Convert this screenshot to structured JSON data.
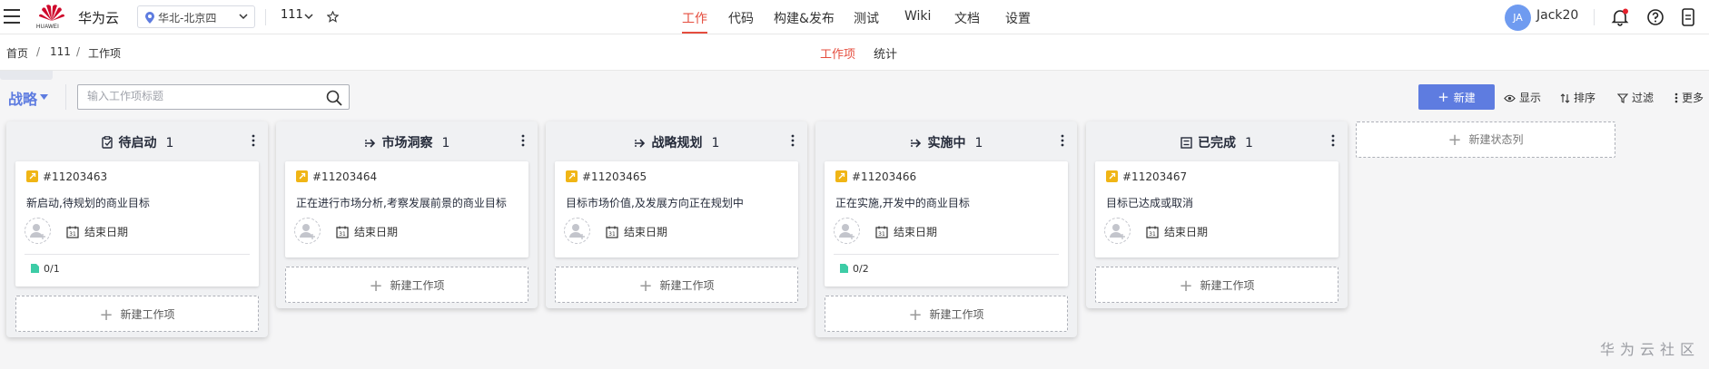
{
  "header": {
    "brand": "华为云",
    "logo_text": "HUAWEI",
    "region": "华北-北京四",
    "project": "111",
    "nav": [
      "工作",
      "代码",
      "构建&发布",
      "测试",
      "Wiki",
      "文档",
      "设置"
    ],
    "active_nav": "工作",
    "user_initials": "JA",
    "username": "Jack20"
  },
  "breadcrumb": [
    "首页",
    "111",
    "工作项"
  ],
  "subtabs": [
    "工作项",
    "统计"
  ],
  "toolbar": {
    "view_title": "战略",
    "search_placeholder": "输入工作项标题",
    "new_button": "新建",
    "display": "显示",
    "sort": "排序",
    "filter": "过滤",
    "more": "更多"
  },
  "columns": [
    {
      "title": "待启动",
      "count": "1",
      "icon": "clipboard-icon",
      "card": {
        "id": "#11203463",
        "desc": "新启动,待规划的商业目标",
        "date_label": "结束日期",
        "sub": "0/1"
      }
    },
    {
      "title": "市场洞察",
      "count": "1",
      "icon": "arrow-right-icon",
      "card": {
        "id": "#11203464",
        "desc": "正在进行市场分析,考察发展前景的商业目标",
        "date_label": "结束日期",
        "sub": null
      }
    },
    {
      "title": "战略规划",
      "count": "1",
      "icon": "arrow-right-icon",
      "card": {
        "id": "#11203465",
        "desc": "目标市场价值,及发展方向正在规划中",
        "date_label": "结束日期",
        "sub": null
      }
    },
    {
      "title": "实施中",
      "count": "1",
      "icon": "arrow-right-icon",
      "card": {
        "id": "#11203466",
        "desc": "正在实施,开发中的商业目标",
        "date_label": "结束日期",
        "sub": "0/2"
      }
    },
    {
      "title": "已完成",
      "count": "1",
      "icon": "list-icon",
      "card": {
        "id": "#11203467",
        "desc": "目标已达成或取消",
        "date_label": "结束日期",
        "sub": null
      }
    }
  ],
  "add_item_label": "新建工作项",
  "add_status_label": "新建状态列",
  "watermark": "华为云社区",
  "colors": {
    "accent": "#5e7ce0",
    "active_red": "#e54d3e",
    "tag_yellow": "#f0b515",
    "sub_green": "#3dcca6"
  }
}
